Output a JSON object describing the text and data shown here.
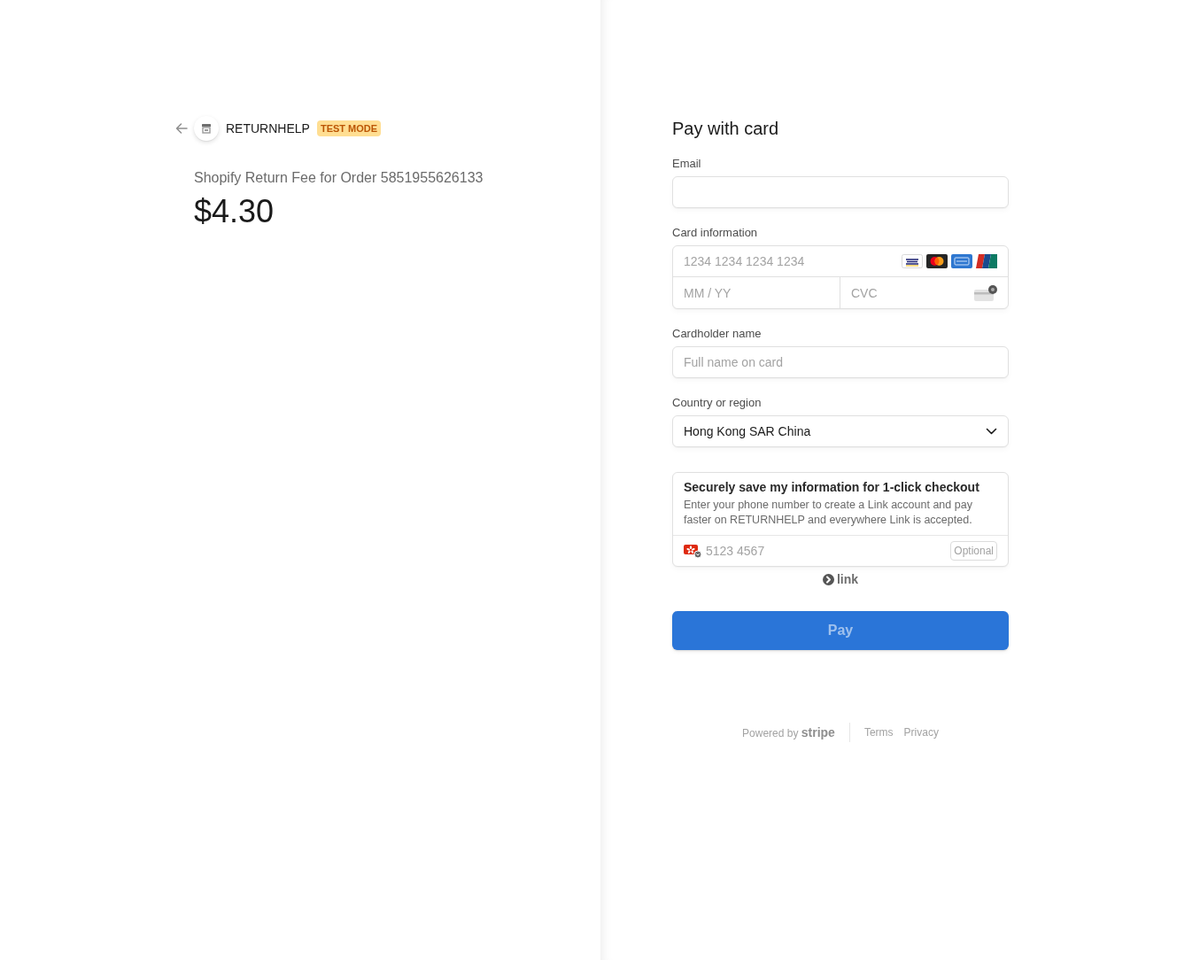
{
  "header": {
    "merchant": "RETURNHELP",
    "badge": "TEST MODE"
  },
  "summary": {
    "description": "Shopify Return Fee for Order 5851955626133",
    "amount": "$4.30"
  },
  "form": {
    "title": "Pay with card",
    "email": {
      "label": "Email"
    },
    "card": {
      "label": "Card information",
      "number": {
        "placeholder": "1234 1234 1234 1234"
      },
      "expiry": {
        "placeholder": "MM / YY"
      },
      "cvc": {
        "placeholder": "CVC"
      }
    },
    "cardholder": {
      "label": "Cardholder name",
      "placeholder": "Full name on card"
    },
    "country": {
      "label": "Country or region",
      "value": "Hong Kong SAR China"
    },
    "link": {
      "title": "Securely save my information for 1-click checkout",
      "description": "Enter your phone number to create a Link account and pay faster on RETURNHELP and everywhere Link is accepted.",
      "phone": {
        "placeholder": "5123 4567"
      },
      "optional": "Optional"
    },
    "link_logo": "link",
    "pay_button": {
      "label": "Pay",
      "disabled": true
    }
  },
  "footer": {
    "powered_by": "Powered by **stripe**",
    "links": [
      "Terms",
      "Privacy"
    ]
  }
}
